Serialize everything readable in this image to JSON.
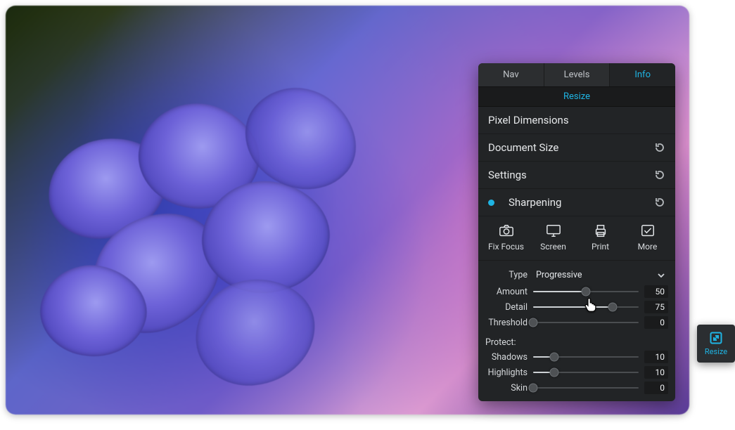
{
  "tabs": {
    "nav": "Nav",
    "levels": "Levels",
    "info": "Info",
    "active": "info"
  },
  "resize_bar": "Resize",
  "sections": {
    "pixel_dimensions": "Pixel Dimensions",
    "document_size": "Document Size",
    "settings": "Settings",
    "sharpening": "Sharpening"
  },
  "presets": {
    "fix_focus": "Fix Focus",
    "screen": "Screen",
    "print": "Print",
    "more": "More"
  },
  "type": {
    "label": "Type",
    "value": "Progressive"
  },
  "sliders": {
    "amount": {
      "label": "Amount",
      "value": 50,
      "pct": 50
    },
    "detail": {
      "label": "Detail",
      "value": 75,
      "pct": 75
    },
    "threshold": {
      "label": "Threshold",
      "value": 0,
      "pct": 0
    }
  },
  "protect": {
    "label": "Protect:",
    "shadows": {
      "label": "Shadows",
      "value": 10,
      "pct": 20
    },
    "highlights": {
      "label": "Highlights",
      "value": 10,
      "pct": 20
    },
    "skin": {
      "label": "Skin",
      "value": 0,
      "pct": 0
    }
  },
  "chip": {
    "label": "Resize"
  },
  "colors": {
    "accent": "#1fb4e3"
  }
}
